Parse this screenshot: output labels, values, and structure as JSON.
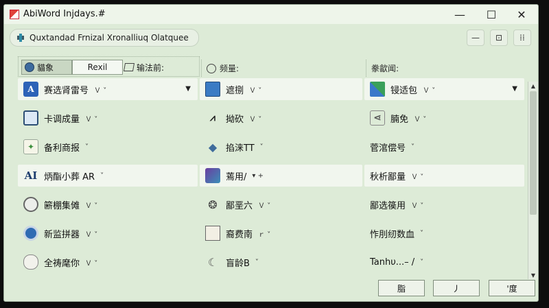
{
  "window": {
    "title": "AbiWord Injdays.#",
    "controls": {
      "minimize": "—",
      "maximize": "☐",
      "close": "✕"
    }
  },
  "subtitle_bar": {
    "title": "Quxtandad Frnizal Xronalliuq Olatquee",
    "tools": [
      "—",
      "⊡",
      "⁞⁞"
    ]
  },
  "tabs": [
    {
      "label": "貓象",
      "icon": "disc-icon"
    },
    {
      "label": "Rexil",
      "icon": ""
    },
    {
      "label": "输法前:",
      "icon": "edit-icon"
    }
  ],
  "section_headers": [
    {
      "label": "频量:",
      "icon": "clock-icon"
    },
    {
      "label": "豢歙闻:",
      "icon": ""
    }
  ],
  "columns": [
    {
      "items": [
        {
          "label": "赛选肾雷号",
          "caret": "Ｖ ˅",
          "icon": "a-icon",
          "highlight": true,
          "dropdown": "▼"
        },
        {
          "label": "卡调成量",
          "caret": "Ｖ ˅",
          "icon": "card-icon",
          "highlight": false
        },
        {
          "label": "备利商报",
          "caret": "˅",
          "icon": "star-icon",
          "highlight": false
        },
        {
          "label": "炳酯小葬 AR",
          "caret": "˅",
          "icon": "ai-icon",
          "highlight": true
        },
        {
          "label": "簖棚集傩",
          "caret": "Ｖ ˅",
          "icon": "gear-icon",
          "highlight": false
        },
        {
          "label": "新监拼器",
          "caret": "Ｖ ˅",
          "icon": "ring-icon",
          "highlight": false
        },
        {
          "label": "全祷麾你",
          "caret": "Ｖ ˅",
          "icon": "cloud-icon",
          "highlight": false
        }
      ]
    },
    {
      "items": [
        {
          "label": "遮捌",
          "caret": "Ｖ ˅",
          "icon": "box-icon",
          "highlight": true
        },
        {
          "label": "拗砍",
          "caret": "Ｖ ˅",
          "icon": "bars-icon",
          "highlight": false
        },
        {
          "label": "掐涞TT",
          "caret": "˅",
          "icon": "cube-icon",
          "highlight": false
        },
        {
          "label": "蔫用/",
          "caret": "▾ +",
          "icon": "picture-icon",
          "highlight": true
        },
        {
          "label": "鄙垩六",
          "caret": "Ｖ ˅",
          "icon": "swirl-icon",
          "highlight": false
        },
        {
          "label": "裔费南",
          "caret": "ｒ ˅",
          "icon": "fold-icon",
          "highlight": false
        },
        {
          "label": "盲龄B",
          "caret": "˅",
          "icon": "moon-icon",
          "highlight": false
        }
      ]
    },
    {
      "items": [
        {
          "label": "锓适包",
          "caret": "Ｖ ˅",
          "icon": "puzzle-icon",
          "highlight": true,
          "dropdown": "▼"
        },
        {
          "label": "腩免",
          "caret": "Ｖ ˅",
          "icon": "share-icon",
          "highlight": false
        },
        {
          "label": "菅涫偿号",
          "caret": "˅",
          "icon": "",
          "highlight": false
        },
        {
          "label": "秋析鄙量",
          "caret": "Ｖ ˅",
          "icon": "",
          "highlight": true
        },
        {
          "label": "鄙选篌用",
          "caret": "Ｖ ˅",
          "icon": "",
          "highlight": false
        },
        {
          "label": "怍刖纫数血",
          "caret": "˅",
          "icon": "",
          "highlight": false
        },
        {
          "label": "Tanhυ...– /",
          "caret": "˅",
          "icon": "",
          "highlight": false
        }
      ]
    }
  ],
  "buttons": [
    "脂",
    "丿",
    "'度"
  ],
  "scrollbar": {
    "up": "▲",
    "down": "▼"
  }
}
